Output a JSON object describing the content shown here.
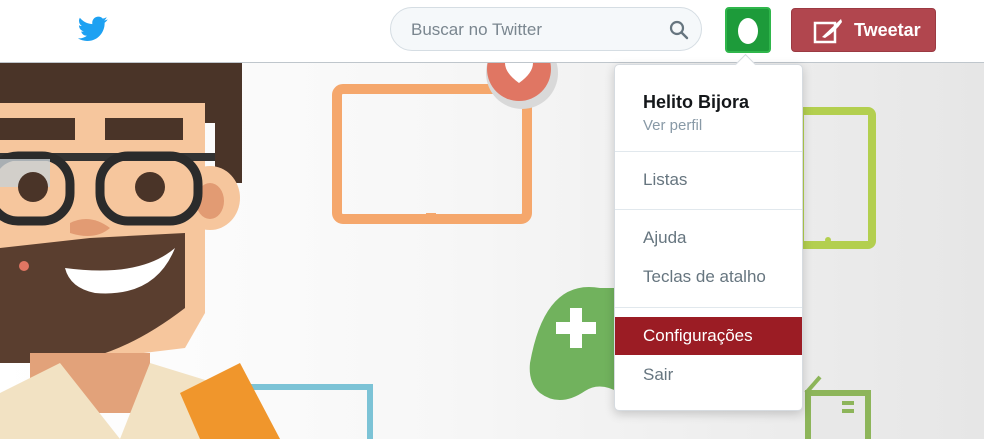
{
  "header": {
    "logo_icon": "twitter-bird-icon",
    "search_placeholder": "Buscar no Twitter",
    "search_icon": "search-icon",
    "avatar_icon": "egg-avatar-icon",
    "tweet_label": "Tweetar",
    "tweet_icon": "compose-quill-icon"
  },
  "menu": {
    "user_name": "Helito Bijora",
    "profile_link": "Ver perfil",
    "items": [
      {
        "label": "Listas"
      },
      {
        "label": "Ajuda"
      },
      {
        "label": "Teclas de atalho"
      },
      {
        "label": "Configurações",
        "active": true
      },
      {
        "label": "Sair"
      }
    ]
  },
  "colors": {
    "brand_blue": "#1da1f2",
    "tweet_button": "#b1464e",
    "active_menu_item": "#9b1c24",
    "avatar_bg": "#1d9b3a"
  }
}
